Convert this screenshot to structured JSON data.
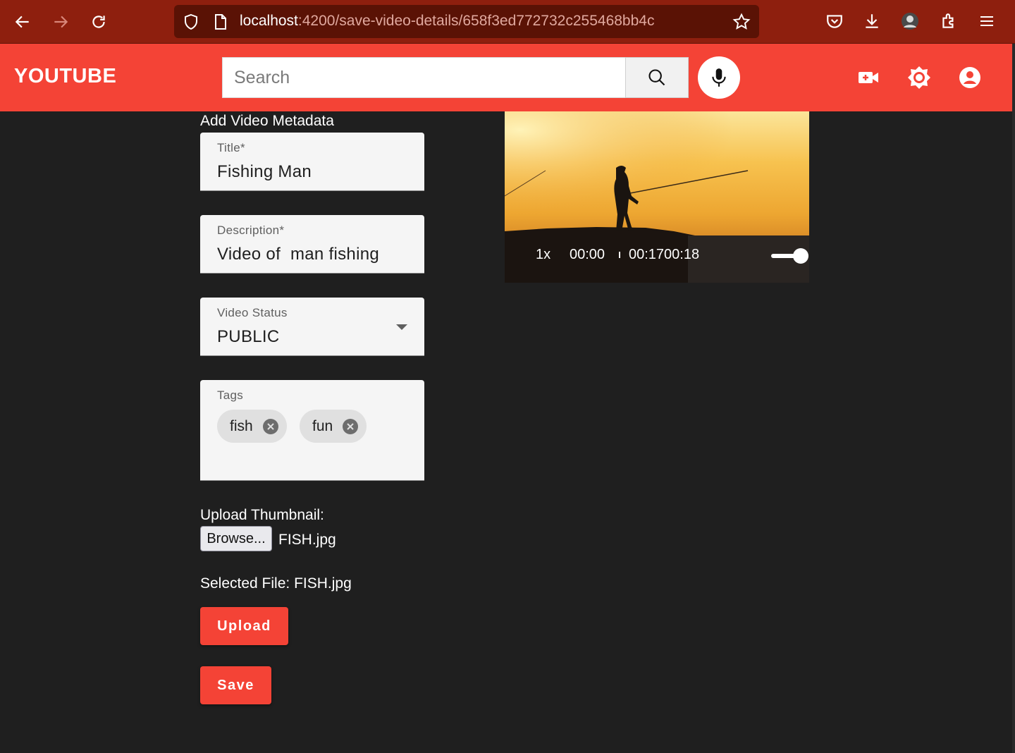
{
  "browser": {
    "url_host": "localhost",
    "url_path": ":4200/save-video-details/658f3ed772732c255468bb4c"
  },
  "header": {
    "brand": "YOUTUBE",
    "search_placeholder": "Search",
    "accent_color": "#f44336"
  },
  "form": {
    "heading": "Add Video Metadata",
    "title": {
      "label": "Title*",
      "value": "Fishing Man"
    },
    "description": {
      "label": "Description*",
      "value": "Video of  man fishing"
    },
    "status": {
      "label": "Video Status",
      "value": "PUBLIC"
    },
    "tags": {
      "label": "Tags",
      "items": [
        "fish",
        "fun"
      ]
    },
    "thumbnail": {
      "label": "Upload Thumbnail:",
      "browse_label": "Browse...",
      "file_name": "FISH.jpg",
      "selected_text": "Selected File: FISH.jpg"
    },
    "upload_label": "Upload",
    "save_label": "Save"
  },
  "video": {
    "speed": "1x",
    "current_time": "00:00",
    "duration_text": "00:1700:18",
    "volume": 1.0
  }
}
